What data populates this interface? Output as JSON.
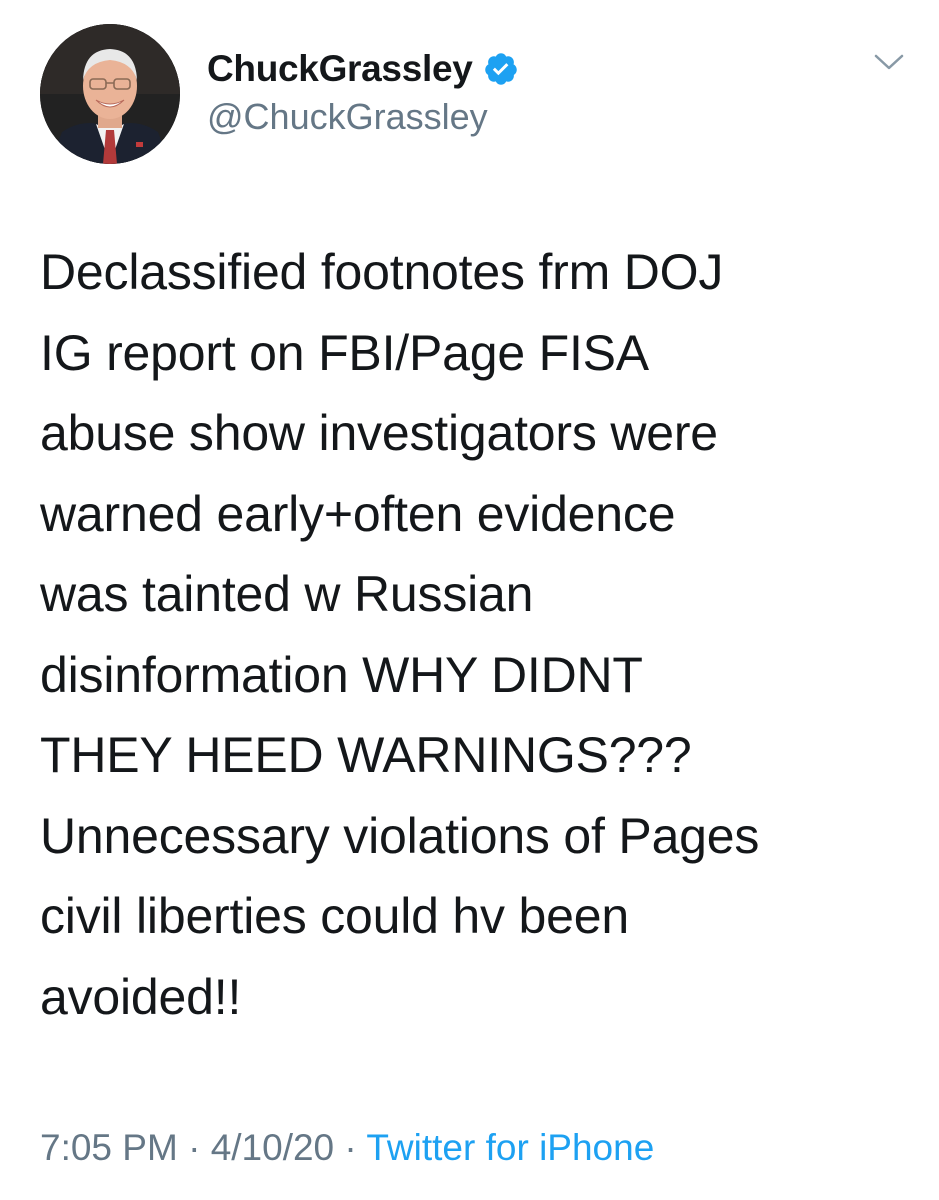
{
  "tweet": {
    "author": {
      "display_name": "ChuckGrassley",
      "handle": "@ChuckGrassley",
      "verified": true,
      "verified_icon": "verified-badge-icon",
      "avatar_icon": "profile-photo"
    },
    "text": "Declassified footnotes frm DOJ\nIG report on FBI/Page FISA\nabuse show investigators were\nwarned early+often evidence\nwas tainted w Russian\ndisinformation WHY DIDNT\nTHEY HEED WARNINGS???\nUnnecessary violations of Pages\ncivil liberties could hv been\navoided!!",
    "time": "7:05 PM",
    "separator": "·",
    "date": "4/10/20",
    "source": "Twitter for iPhone",
    "menu_icon": "chevron-down-icon"
  },
  "colors": {
    "text_primary": "#14171a",
    "text_secondary": "#657786",
    "accent": "#1da1f2"
  }
}
